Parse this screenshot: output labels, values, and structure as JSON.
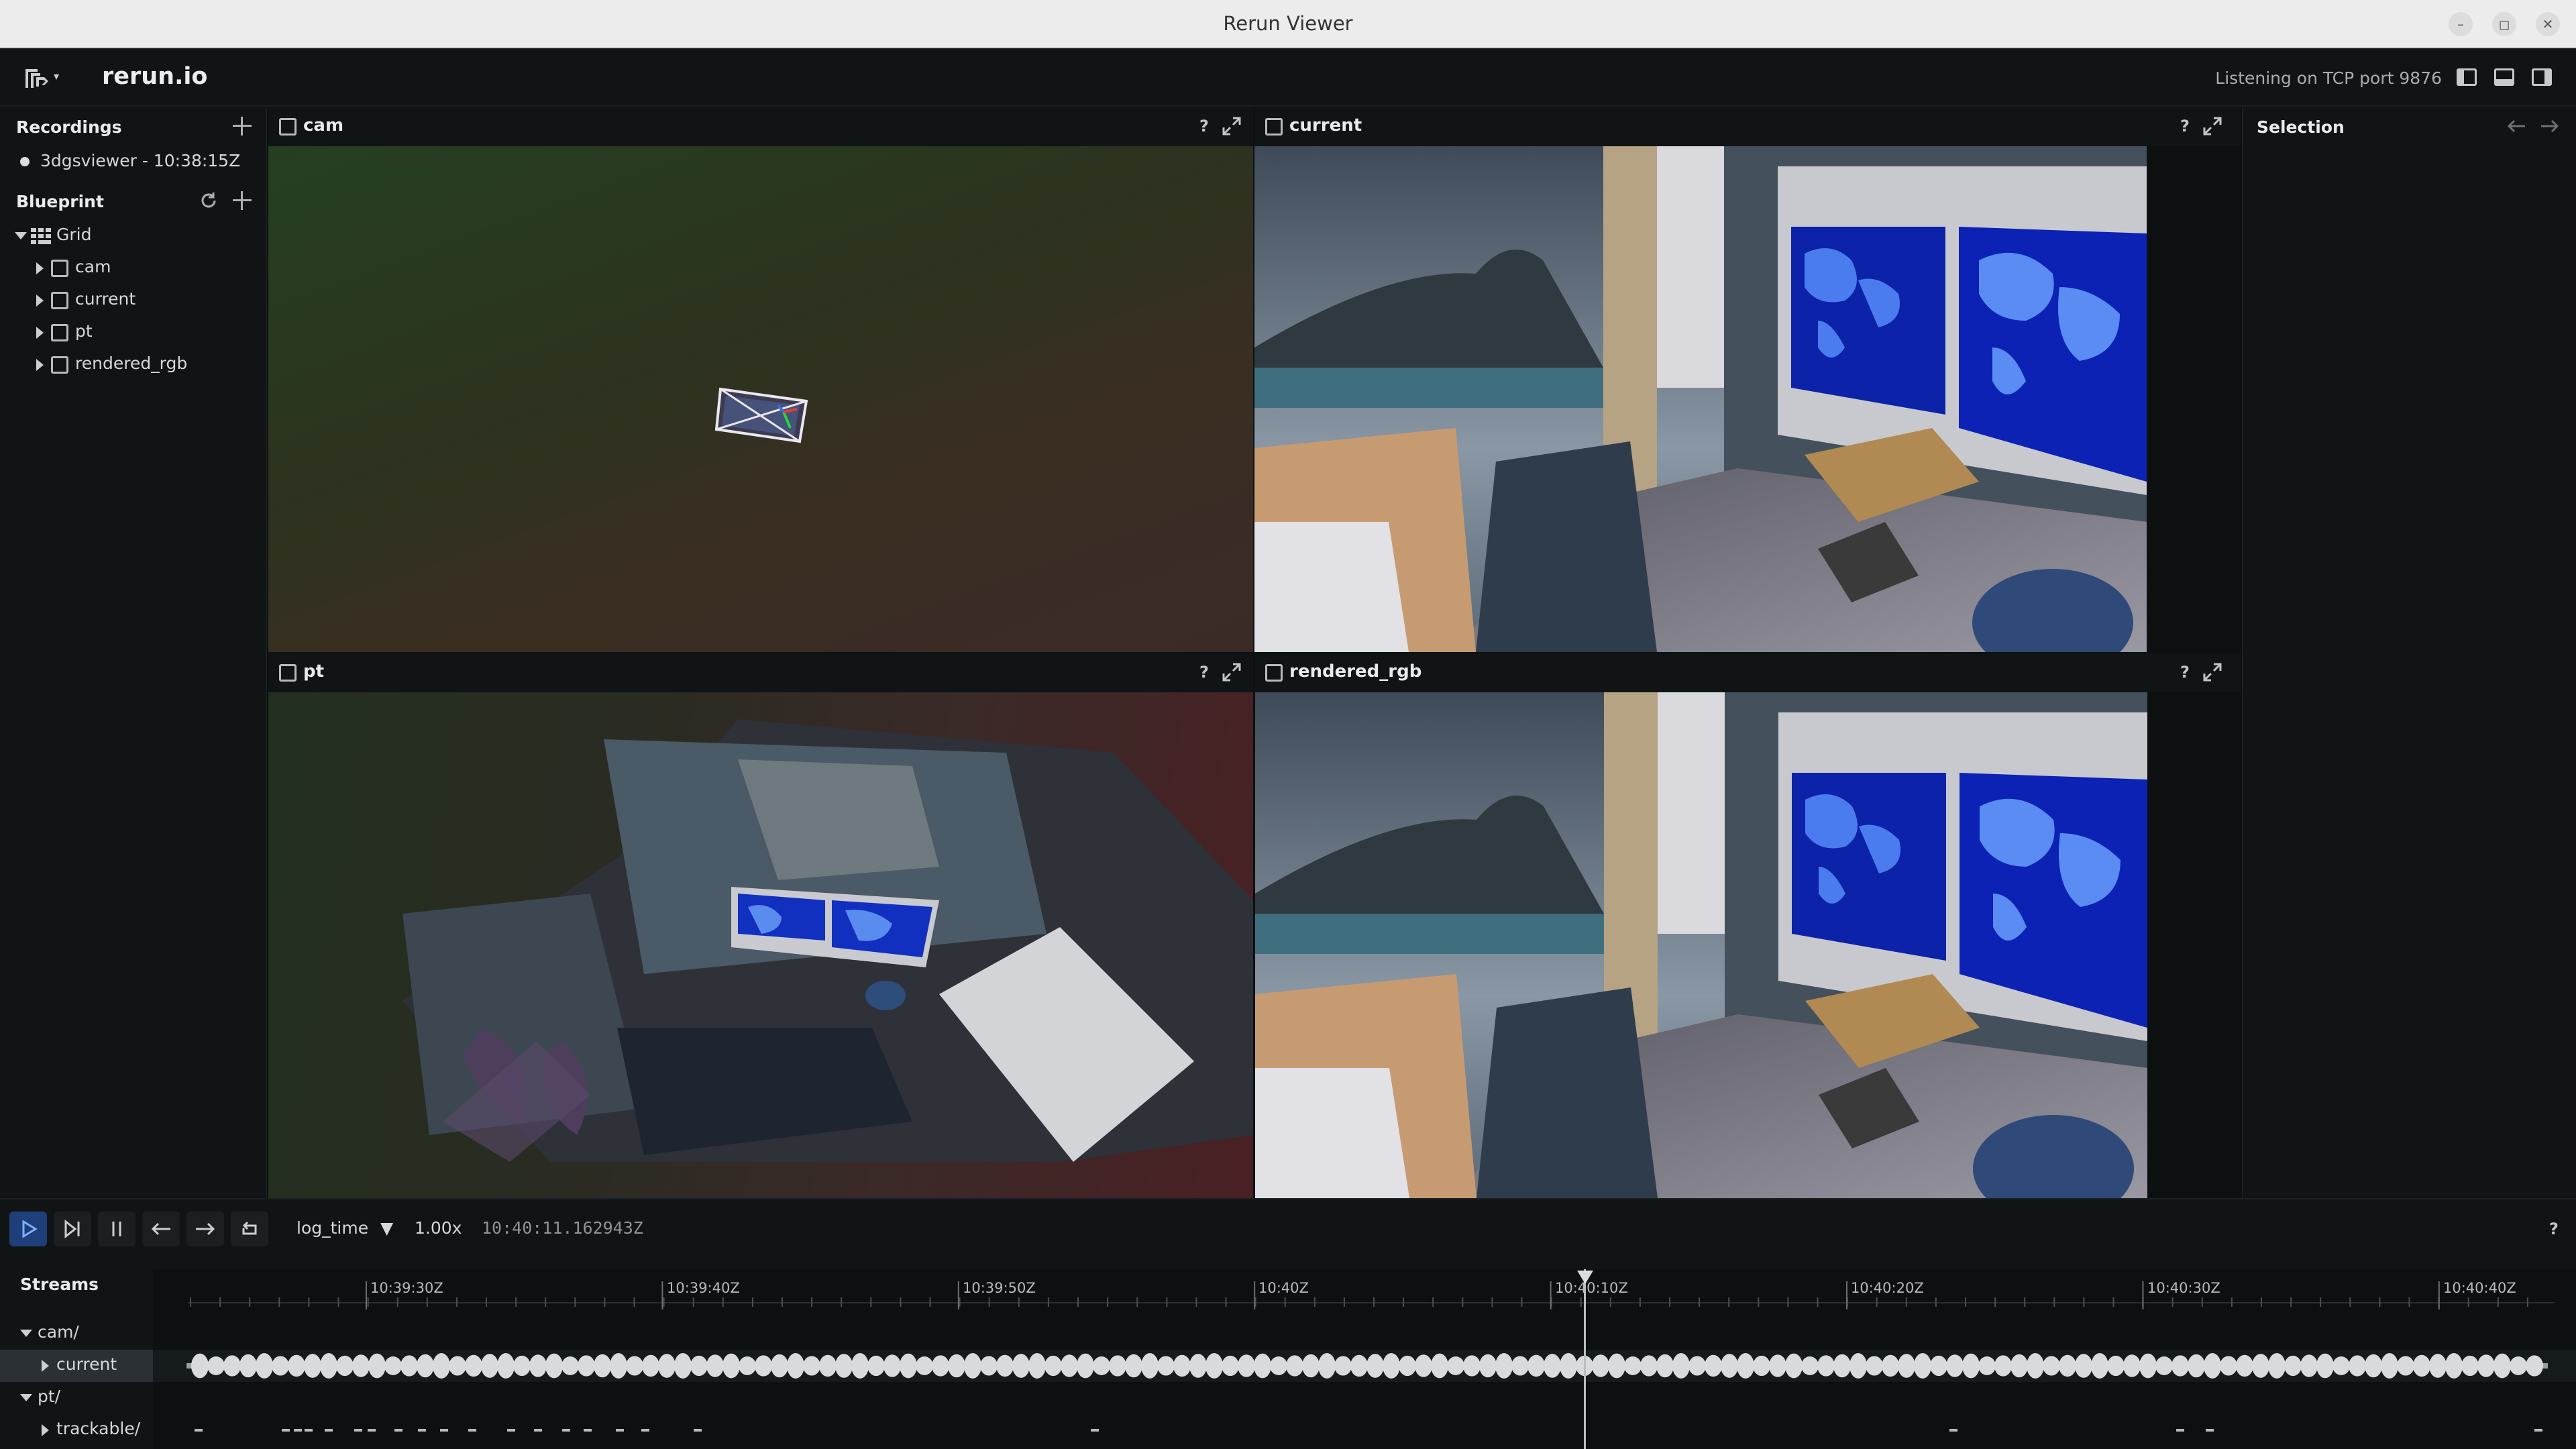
{
  "window": {
    "title": "Rerun Viewer",
    "controls": {
      "minimize": "–",
      "maximize": "◻",
      "close": "✕"
    }
  },
  "topbar": {
    "app_name": "rerun.io",
    "status": "Listening on TCP port 9876"
  },
  "recordings": {
    "header": "Recordings",
    "items": [
      {
        "label": "3dgsviewer - 10:38:15Z"
      }
    ]
  },
  "blueprint": {
    "header": "Blueprint",
    "root": "Grid",
    "children": [
      {
        "label": "cam",
        "kind": "spatial-2d"
      },
      {
        "label": "current",
        "kind": "spatial-3d"
      },
      {
        "label": "pt",
        "kind": "spatial-2d"
      },
      {
        "label": "rendered_rgb",
        "kind": "spatial-3d"
      }
    ]
  },
  "views": {
    "cam": {
      "title": "cam",
      "help": "?"
    },
    "current": {
      "title": "current",
      "help": "?"
    },
    "pt": {
      "title": "pt",
      "help": "?"
    },
    "rendered_rgb": {
      "title": "rendered_rgb",
      "help": "?"
    }
  },
  "selection": {
    "header": "Selection"
  },
  "timeline": {
    "timeline_name": "log_time",
    "speed": "1.00x",
    "current_time": "10:40:11.162943Z",
    "help": "?",
    "ticks": [
      "10:39:30Z",
      "10:39:40Z",
      "10:39:50Z",
      "10:40Z",
      "10:40:10Z",
      "10:40:20Z",
      "10:40:30Z",
      "10:40:40Z"
    ],
    "streams_header": "Streams",
    "streams": [
      {
        "label": "cam/",
        "expanded": true
      },
      {
        "label": "current",
        "expanded": false,
        "selected": true
      },
      {
        "label": "pt/",
        "expanded": true
      },
      {
        "label": "trackable/",
        "expanded": false
      }
    ]
  },
  "colors": {
    "accent": "#2b6cde",
    "panel_bg": "#111415",
    "view_bg": "#0d1011",
    "text": "#cacfd1"
  },
  "icons": {
    "play": "play-icon",
    "step": "step-forward-icon",
    "pause": "pause-icon",
    "prev": "arrow-left-icon",
    "next": "arrow-right-icon",
    "loop": "loop-icon"
  }
}
